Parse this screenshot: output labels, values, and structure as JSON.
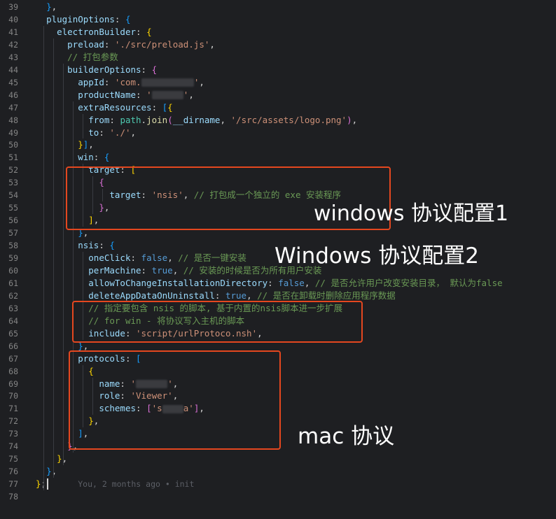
{
  "lines": [
    {
      "n": "39",
      "tokens": [
        [
          "punc",
          "  "
        ],
        [
          "br3",
          "}"
        ],
        [
          "punc",
          ","
        ]
      ]
    },
    {
      "n": "40",
      "tokens": [
        [
          "punc",
          "  "
        ],
        [
          "prop",
          "pluginOptions"
        ],
        [
          "punc",
          ": "
        ],
        [
          "br3",
          "{"
        ]
      ]
    },
    {
      "n": "41",
      "tokens": [
        [
          "punc",
          "    "
        ],
        [
          "prop",
          "electronBuilder"
        ],
        [
          "punc",
          ": "
        ],
        [
          "br1",
          "{"
        ]
      ]
    },
    {
      "n": "42",
      "tokens": [
        [
          "punc",
          "      "
        ],
        [
          "prop",
          "preload"
        ],
        [
          "punc",
          ": "
        ],
        [
          "str",
          "'./src/preload.js'"
        ],
        [
          "punc",
          ","
        ]
      ]
    },
    {
      "n": "43",
      "tokens": [
        [
          "punc",
          "      "
        ],
        [
          "com",
          "// 打包参数"
        ]
      ]
    },
    {
      "n": "44",
      "tokens": [
        [
          "punc",
          "      "
        ],
        [
          "prop",
          "builderOptions"
        ],
        [
          "punc",
          ": "
        ],
        [
          "br2",
          "{"
        ]
      ]
    },
    {
      "n": "45",
      "tokens": [
        [
          "punc",
          "        "
        ],
        [
          "prop",
          "appId"
        ],
        [
          "punc",
          ": "
        ],
        [
          "str",
          "'com."
        ],
        [
          "blur",
          "xxxxxxxxxx"
        ],
        [
          "str",
          "'"
        ],
        [
          "punc",
          ","
        ]
      ]
    },
    {
      "n": "46",
      "tokens": [
        [
          "punc",
          "        "
        ],
        [
          "prop",
          "productName"
        ],
        [
          "punc",
          ": "
        ],
        [
          "str",
          "'"
        ],
        [
          "blur",
          "xxxxxx"
        ],
        [
          "str",
          "'"
        ],
        [
          "punc",
          ","
        ]
      ]
    },
    {
      "n": "47",
      "tokens": [
        [
          "punc",
          "        "
        ],
        [
          "prop",
          "extraResources"
        ],
        [
          "punc",
          ": "
        ],
        [
          "br3",
          "["
        ],
        [
          "br1",
          "{"
        ]
      ]
    },
    {
      "n": "48",
      "tokens": [
        [
          "punc",
          "          "
        ],
        [
          "prop",
          "from"
        ],
        [
          "punc",
          ": "
        ],
        [
          "obj",
          "path"
        ],
        [
          "punc",
          "."
        ],
        [
          "fn",
          "join"
        ],
        [
          "br2",
          "("
        ],
        [
          "var",
          "__dirname"
        ],
        [
          "punc",
          ", "
        ],
        [
          "str",
          "'/src/assets/logo.png'"
        ],
        [
          "br2",
          ")"
        ],
        [
          "punc",
          ","
        ]
      ]
    },
    {
      "n": "49",
      "tokens": [
        [
          "punc",
          "          "
        ],
        [
          "prop",
          "to"
        ],
        [
          "punc",
          ": "
        ],
        [
          "str",
          "'./'"
        ],
        [
          "punc",
          ","
        ]
      ]
    },
    {
      "n": "50",
      "tokens": [
        [
          "punc",
          "        "
        ],
        [
          "br1",
          "}"
        ],
        [
          "br3",
          "]"
        ],
        [
          "punc",
          ","
        ]
      ]
    },
    {
      "n": "51",
      "tokens": [
        [
          "punc",
          "        "
        ],
        [
          "prop",
          "win"
        ],
        [
          "punc",
          ": "
        ],
        [
          "br3",
          "{"
        ]
      ]
    },
    {
      "n": "52",
      "tokens": [
        [
          "punc",
          "          "
        ],
        [
          "prop",
          "target"
        ],
        [
          "punc",
          ": "
        ],
        [
          "br1",
          "["
        ]
      ]
    },
    {
      "n": "53",
      "tokens": [
        [
          "punc",
          "            "
        ],
        [
          "br2",
          "{"
        ]
      ]
    },
    {
      "n": "54",
      "tokens": [
        [
          "punc",
          "              "
        ],
        [
          "prop",
          "target"
        ],
        [
          "punc",
          ": "
        ],
        [
          "str",
          "'nsis'"
        ],
        [
          "punc",
          ", "
        ],
        [
          "com",
          "// 打包成一个独立的 exe 安装程序"
        ]
      ]
    },
    {
      "n": "55",
      "tokens": [
        [
          "punc",
          "            "
        ],
        [
          "br2",
          "}"
        ],
        [
          "punc",
          ","
        ]
      ]
    },
    {
      "n": "56",
      "tokens": [
        [
          "punc",
          "          "
        ],
        [
          "br1",
          "]"
        ],
        [
          "punc",
          ","
        ]
      ]
    },
    {
      "n": "57",
      "tokens": [
        [
          "punc",
          "        "
        ],
        [
          "br3",
          "}"
        ],
        [
          "punc",
          ","
        ]
      ]
    },
    {
      "n": "58",
      "tokens": [
        [
          "punc",
          "        "
        ],
        [
          "prop",
          "nsis"
        ],
        [
          "punc",
          ": "
        ],
        [
          "br3",
          "{"
        ]
      ]
    },
    {
      "n": "59",
      "tokens": [
        [
          "punc",
          "          "
        ],
        [
          "prop",
          "oneClick"
        ],
        [
          "punc",
          ": "
        ],
        [
          "kw",
          "false"
        ],
        [
          "punc",
          ", "
        ],
        [
          "com",
          "// 是否一键安装"
        ]
      ]
    },
    {
      "n": "60",
      "tokens": [
        [
          "punc",
          "          "
        ],
        [
          "prop",
          "perMachine"
        ],
        [
          "punc",
          ": "
        ],
        [
          "kw",
          "true"
        ],
        [
          "punc",
          ", "
        ],
        [
          "com",
          "// 安装的时候是否为所有用户安装"
        ]
      ]
    },
    {
      "n": "61",
      "tokens": [
        [
          "punc",
          "          "
        ],
        [
          "prop",
          "allowToChangeInstallationDirectory"
        ],
        [
          "punc",
          ": "
        ],
        [
          "kw",
          "false"
        ],
        [
          "punc",
          ", "
        ],
        [
          "com",
          "// 是否允许用户改变安装目录， 默认为false"
        ]
      ]
    },
    {
      "n": "62",
      "tokens": [
        [
          "punc",
          "          "
        ],
        [
          "prop",
          "deleteAppDataOnUninstall"
        ],
        [
          "punc",
          ": "
        ],
        [
          "kw",
          "true"
        ],
        [
          "punc",
          ", "
        ],
        [
          "com",
          "// 是否在卸载时删除应用程序数据"
        ]
      ]
    },
    {
      "n": "63",
      "tokens": [
        [
          "punc",
          "          "
        ],
        [
          "com",
          "// 指定要包含 nsis 的脚本, 基于内置的nsis脚本进一步扩展"
        ]
      ]
    },
    {
      "n": "64",
      "tokens": [
        [
          "punc",
          "          "
        ],
        [
          "com",
          "// for win - 将协议写入主机的脚本"
        ]
      ]
    },
    {
      "n": "65",
      "tokens": [
        [
          "punc",
          "          "
        ],
        [
          "prop",
          "include"
        ],
        [
          "punc",
          ": "
        ],
        [
          "str",
          "'script/urlProtoco.nsh'"
        ],
        [
          "punc",
          ","
        ]
      ]
    },
    {
      "n": "66",
      "tokens": [
        [
          "punc",
          "        "
        ],
        [
          "br3",
          "}"
        ],
        [
          "punc",
          ","
        ]
      ]
    },
    {
      "n": "67",
      "tokens": [
        [
          "punc",
          "        "
        ],
        [
          "prop",
          "protocols"
        ],
        [
          "punc",
          ": "
        ],
        [
          "br3",
          "["
        ]
      ]
    },
    {
      "n": "68",
      "tokens": [
        [
          "punc",
          "          "
        ],
        [
          "br1",
          "{"
        ]
      ]
    },
    {
      "n": "69",
      "tokens": [
        [
          "punc",
          "            "
        ],
        [
          "prop",
          "name"
        ],
        [
          "punc",
          ": "
        ],
        [
          "str",
          "'"
        ],
        [
          "blur",
          "xxxxxx"
        ],
        [
          "str",
          "'"
        ],
        [
          "punc",
          ","
        ]
      ]
    },
    {
      "n": "70",
      "tokens": [
        [
          "punc",
          "            "
        ],
        [
          "prop",
          "role"
        ],
        [
          "punc",
          ": "
        ],
        [
          "str",
          "'Viewer'"
        ],
        [
          "punc",
          ","
        ]
      ]
    },
    {
      "n": "71",
      "tokens": [
        [
          "punc",
          "            "
        ],
        [
          "prop",
          "schemes"
        ],
        [
          "punc",
          ": "
        ],
        [
          "br2",
          "["
        ],
        [
          "str",
          "'s"
        ],
        [
          "blur",
          "xxxx"
        ],
        [
          "str",
          "a'"
        ],
        [
          "br2",
          "]"
        ],
        [
          "punc",
          ","
        ]
      ]
    },
    {
      "n": "72",
      "tokens": [
        [
          "punc",
          "          "
        ],
        [
          "br1",
          "}"
        ],
        [
          "punc",
          ","
        ]
      ]
    },
    {
      "n": "73",
      "tokens": [
        [
          "punc",
          "        "
        ],
        [
          "br3",
          "]"
        ],
        [
          "punc",
          ","
        ]
      ]
    },
    {
      "n": "74",
      "tokens": [
        [
          "punc",
          "      "
        ],
        [
          "br2",
          "}"
        ],
        [
          "punc",
          ","
        ]
      ]
    },
    {
      "n": "75",
      "tokens": [
        [
          "punc",
          "    "
        ],
        [
          "br1",
          "}"
        ],
        [
          "punc",
          ","
        ]
      ]
    },
    {
      "n": "76",
      "tokens": [
        [
          "punc",
          "  "
        ],
        [
          "br3",
          "}"
        ],
        [
          "punc",
          ","
        ]
      ]
    },
    {
      "n": "77",
      "tokens": [
        [
          "br1",
          "}"
        ],
        [
          "punc",
          ";"
        ],
        [
          "punc",
          "      "
        ],
        [
          "blame",
          "You, 2 months ago • init"
        ]
      ]
    },
    {
      "n": "78",
      "tokens": []
    }
  ],
  "annotations": {
    "windows1": "windows 协议配置1",
    "windows2": "Windows 协议配置2",
    "mac": "mac 协议"
  },
  "colors": {
    "highlight_box": "#e4471f",
    "background": "#1e1f22"
  }
}
